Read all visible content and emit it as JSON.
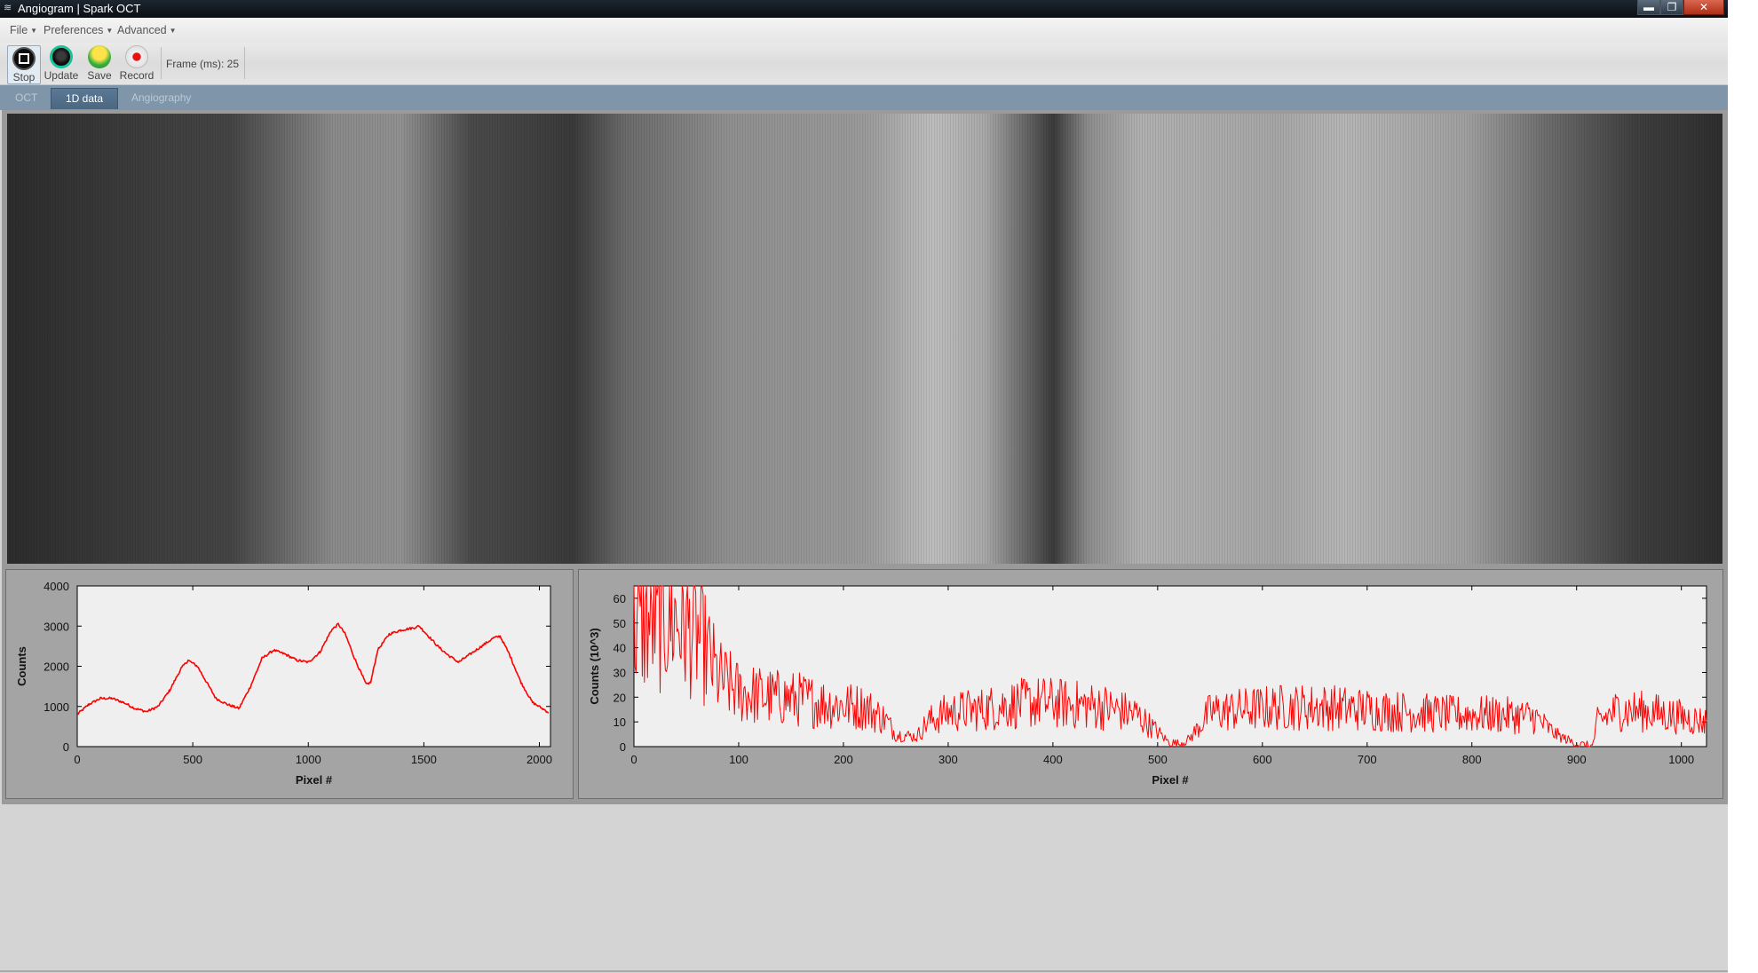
{
  "window": {
    "title": "Angiogram | Spark OCT",
    "buttons": {
      "minimize": "▬",
      "maximize": "❐",
      "close": "✕"
    }
  },
  "menu": [
    {
      "label": "File"
    },
    {
      "label": "Preferences"
    },
    {
      "label": "Advanced"
    }
  ],
  "toolbar": {
    "stop_label": "Stop",
    "update_label": "Update",
    "save_label": "Save",
    "record_label": "Record",
    "frame_text": "Frame (ms): 25"
  },
  "tabs": [
    {
      "label": "OCT"
    },
    {
      "label": "1D data"
    },
    {
      "label": "Angiography"
    }
  ],
  "active_tab": "1D data",
  "colors": {
    "trace": "#ff0000",
    "plot_bg": "#efefef",
    "panel_bg": "#a4a4a4",
    "tab_active": "#4b6782"
  },
  "chart_data": [
    {
      "type": "line",
      "xlabel": "Pixel #",
      "ylabel": "Counts",
      "xlim": [
        0,
        2048
      ],
      "ylim": [
        0,
        4000
      ],
      "xticks": [
        0,
        500,
        1000,
        1500,
        2000
      ],
      "yticks": [
        0,
        1000,
        2000,
        3000,
        4000
      ],
      "series": [
        {
          "color": "#ff0000",
          "x": [
            0,
            50,
            100,
            150,
            200,
            250,
            300,
            350,
            400,
            450,
            480,
            520,
            560,
            600,
            650,
            700,
            750,
            800,
            850,
            900,
            950,
            1000,
            1050,
            1100,
            1130,
            1160,
            1200,
            1250,
            1270,
            1300,
            1350,
            1400,
            1450,
            1480,
            1520,
            1560,
            1600,
            1650,
            1700,
            1750,
            1800,
            1830,
            1870,
            1920,
            1970,
            2040
          ],
          "y": [
            800,
            1050,
            1200,
            1200,
            1100,
            950,
            870,
            1000,
            1400,
            1950,
            2150,
            2000,
            1600,
            1200,
            1050,
            950,
            1500,
            2200,
            2400,
            2300,
            2150,
            2100,
            2350,
            2900,
            3050,
            2800,
            2200,
            1550,
            1600,
            2400,
            2800,
            2900,
            2950,
            3000,
            2750,
            2500,
            2300,
            2100,
            2300,
            2500,
            2700,
            2750,
            2300,
            1600,
            1100,
            850
          ]
        }
      ]
    },
    {
      "type": "line",
      "xlabel": "Pixel #",
      "ylabel": "Counts (10^3)",
      "xlim": [
        0,
        1024
      ],
      "ylim": [
        0,
        65
      ],
      "xticks": [
        0,
        100,
        200,
        300,
        400,
        500,
        600,
        700,
        800,
        900,
        1000
      ],
      "yticks": [
        0,
        10,
        20,
        30,
        40,
        50,
        60
      ],
      "series": [
        {
          "color": "#ff0000",
          "x": [
            0,
            20,
            40,
            60,
            70,
            80,
            100,
            130,
            160,
            190,
            220,
            240,
            250,
            270,
            280,
            300,
            330,
            360,
            390,
            420,
            450,
            480,
            500,
            510,
            520,
            530,
            550,
            580,
            620,
            660,
            700,
            740,
            780,
            820,
            860,
            880,
            900,
            915,
            920,
            940,
            970,
            1000,
            1024
          ],
          "y": [
            48,
            51,
            52,
            45,
            38,
            28,
            22,
            20,
            19,
            17,
            16,
            11,
            5,
            4,
            10,
            14,
            15,
            17,
            18,
            17,
            16,
            13,
            6,
            2,
            1,
            3,
            14,
            15,
            16,
            16,
            15,
            14,
            13,
            13,
            12,
            5,
            1,
            0,
            10,
            15,
            14,
            12,
            10
          ]
        }
      ]
    }
  ]
}
